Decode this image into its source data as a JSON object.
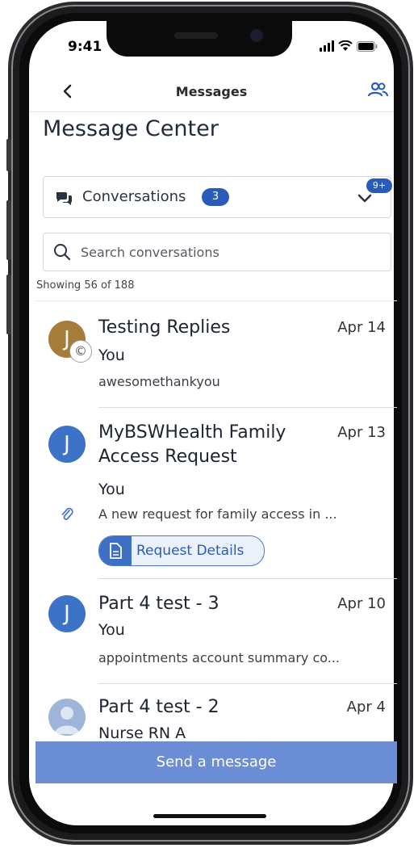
{
  "status": {
    "time": "9:41"
  },
  "nav": {
    "title": "Messages"
  },
  "page": {
    "title": "Message Center"
  },
  "conversations": {
    "label": "Conversations",
    "count": "3",
    "badge": "9+"
  },
  "search": {
    "placeholder": "Search conversations"
  },
  "showing": "Showing 56 of 188",
  "messages": [
    {
      "subject": "Testing Replies",
      "date": "Apr 14",
      "sender": "You",
      "preview": "awesomethankyou",
      "avatar": "J",
      "avatar_color": "#a67c3b",
      "badge": "©"
    },
    {
      "subject": "MyBSWHealth Family Access Request",
      "date": "Apr 13",
      "sender": "You",
      "preview": "A new request for family access in ...",
      "avatar": "J",
      "avatar_color": "#3d73c6",
      "action_label": "Request Details"
    },
    {
      "subject": "Part 4 test - 3",
      "date": "Apr 10",
      "sender": "You",
      "preview": "appointments account summary co...",
      "avatar": "J",
      "avatar_color": "#3d73c6"
    },
    {
      "subject": "Part 4 test - 2",
      "date": "Apr 4",
      "sender": "Nurse RN A",
      "preview": "",
      "avatar": "",
      "avatar_color": "#9fb4d9"
    }
  ],
  "send_button": "Send a message",
  "colors": {
    "accent": "#2a5bb8",
    "send_bar": "#6a8dd6"
  }
}
